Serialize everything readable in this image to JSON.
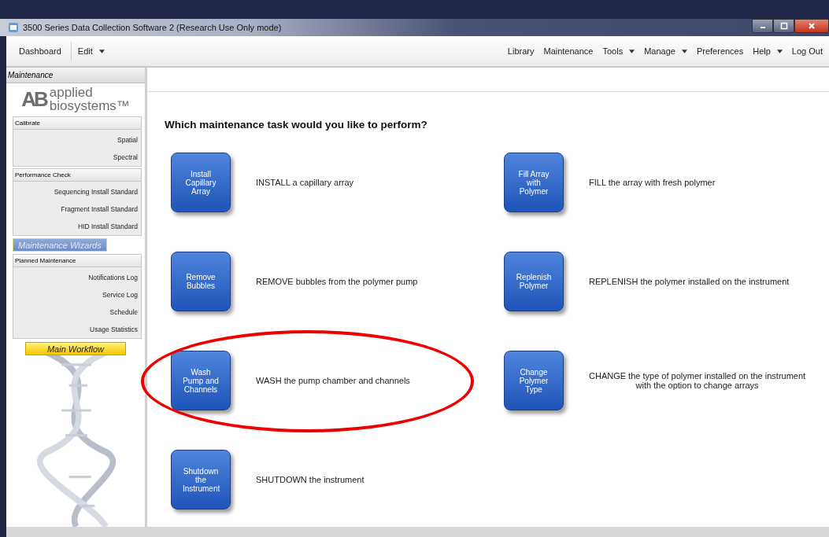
{
  "window": {
    "title": "3500 Series Data Collection Software 2 (Research Use Only mode)"
  },
  "toolbar": {
    "left": [
      {
        "label": "Dashboard",
        "dropdown": false
      },
      {
        "label": "Edit",
        "dropdown": true
      }
    ],
    "right": [
      {
        "label": "Library",
        "dropdown": false
      },
      {
        "label": "Maintenance",
        "dropdown": false
      },
      {
        "label": "Tools",
        "dropdown": true
      },
      {
        "label": "Manage",
        "dropdown": true
      },
      {
        "label": "Preferences",
        "dropdown": false
      },
      {
        "label": "Help",
        "dropdown": true
      },
      {
        "label": "Log Out",
        "dropdown": false
      }
    ]
  },
  "sidebar": {
    "title": "Maintenance",
    "logo": {
      "mark": "AB",
      "line_1": "applied",
      "line_2": "biosystems™"
    },
    "sections": [
      {
        "kind": "group",
        "label": "Calibrate",
        "items": [
          "Spatial",
          "Spectral"
        ]
      },
      {
        "kind": "group",
        "label": "Performance Check",
        "items": [
          "Sequencing Install Standard",
          "Fragment Install Standard",
          "HID Install Standard"
        ]
      },
      {
        "kind": "button",
        "label": "Maintenance Wizards",
        "selected": true
      },
      {
        "kind": "group",
        "label": "Planned Maintenance",
        "items": [
          "Notifications Log",
          "Service Log",
          "Schedule",
          "Usage Statistics"
        ]
      }
    ],
    "workflow_button": "Main Workflow"
  },
  "main": {
    "heading": "Which maintenance task would you like to perform?",
    "tasks": [
      {
        "button": "Install Capillary Array",
        "description": "INSTALL a capillary array",
        "circled": false
      },
      {
        "button": "Fill Array with Polymer",
        "description": "FILL the array with fresh polymer",
        "circled": false
      },
      {
        "button": "Remove Bubbles",
        "description": "REMOVE bubbles from the polymer pump",
        "circled": false
      },
      {
        "button": "Replenish Polymer",
        "description": "REPLENISH the polymer installed on the instrument",
        "circled": false
      },
      {
        "button": "Wash Pump and Channels",
        "description": "WASH the pump chamber and channels",
        "circled": true
      },
      {
        "button": "Change Polymer Type",
        "description": "CHANGE the type of polymer installed on the instrument\nwith the option to change arrays",
        "circled": false
      },
      {
        "button": "Shutdown the Instrument",
        "description": "SHUTDOWN the instrument",
        "circled": false
      }
    ]
  }
}
